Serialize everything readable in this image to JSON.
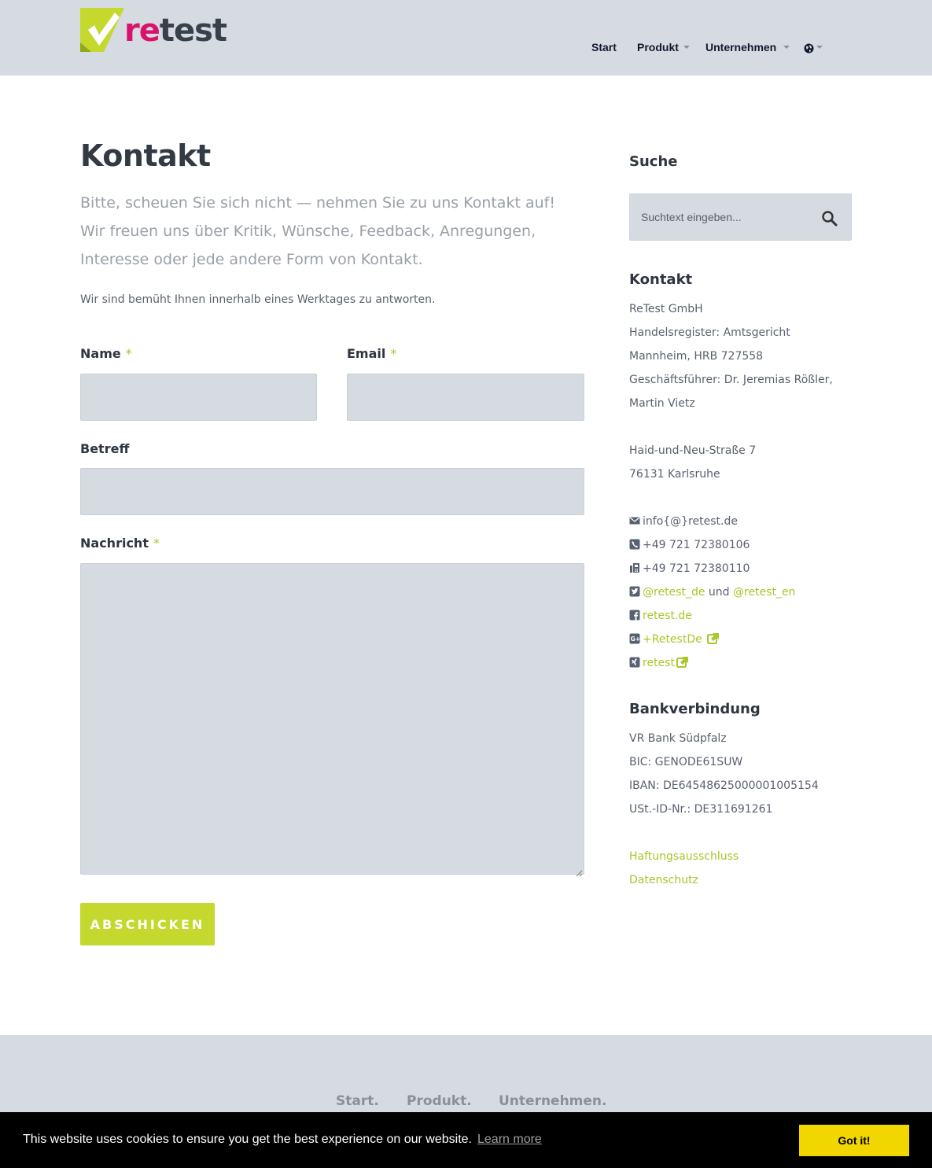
{
  "header": {
    "logo": {
      "re": "re",
      "test": "test"
    },
    "nav": [
      {
        "label": "Start"
      },
      {
        "label": "Produkt"
      },
      {
        "label": "Unternehmen"
      }
    ]
  },
  "main": {
    "title": "Kontakt",
    "lead": "Bitte, scheuen Sie sich nicht — nehmen Sie zu uns Kontakt auf! Wir freuen uns über Kritik, Wünsche, Feedback, Anregungen, Interesse oder jede andere Form von Kontakt.",
    "note": "Wir sind bemüht Ihnen innerhalb eines Werktages zu antworten.",
    "form": {
      "name_label": "Name",
      "email_label": "Email",
      "subject_label": "Betreff",
      "message_label": "Nachricht",
      "required_mark": "*",
      "name_value": "",
      "email_value": "",
      "subject_value": "",
      "message_value": "",
      "submit_label": "ABSCHICKEN"
    }
  },
  "sidebar": {
    "search_heading": "Suche",
    "search_placeholder": "Suchtext eingeben...",
    "contact_heading": "Kontakt",
    "company": "ReTest GmbH",
    "register_1": "Handelsregister: Amtsgericht",
    "register_2": "Mannheim, HRB 727558",
    "ceo_1": "Geschäftsführer: Dr. Jeremias Rößler,",
    "ceo_2": "Martin Vietz",
    "street": "Haid-und-Neu-Straße 7",
    "city": "76131 Karlsruhe",
    "email": "info{@}retest.de",
    "phone": "+49 721 72380106",
    "fax": "+49 721 72380110",
    "twitter_de": "@retest_de",
    "twitter_and": "und",
    "twitter_en": "@retest_en",
    "facebook": "retest.de",
    "gplus": "+RetestDe",
    "xing": "retest",
    "bank_heading": "Bankverbindung",
    "bank_name": "VR Bank Südpfalz",
    "bic": "BIC: GENODE61SUW",
    "iban": "IBAN: DE64548625000001005154",
    "vat": "USt.-ID-Nr.: DE311691261",
    "disclaimer": "Haftungsausschluss",
    "privacy": "Datenschutz"
  },
  "footer": {
    "nav": [
      "Start.",
      "Produkt.",
      "Unternehmen."
    ]
  },
  "cookie": {
    "message": "This website uses cookies to ensure you get the best experience on our website.",
    "learn_more": "Learn more",
    "accept": "Got it!"
  },
  "colors": {
    "accent": "#c4d82e",
    "brand_pink": "#d9126b",
    "header_bg": "#d6dae1",
    "cookie_button": "#f1d600"
  }
}
